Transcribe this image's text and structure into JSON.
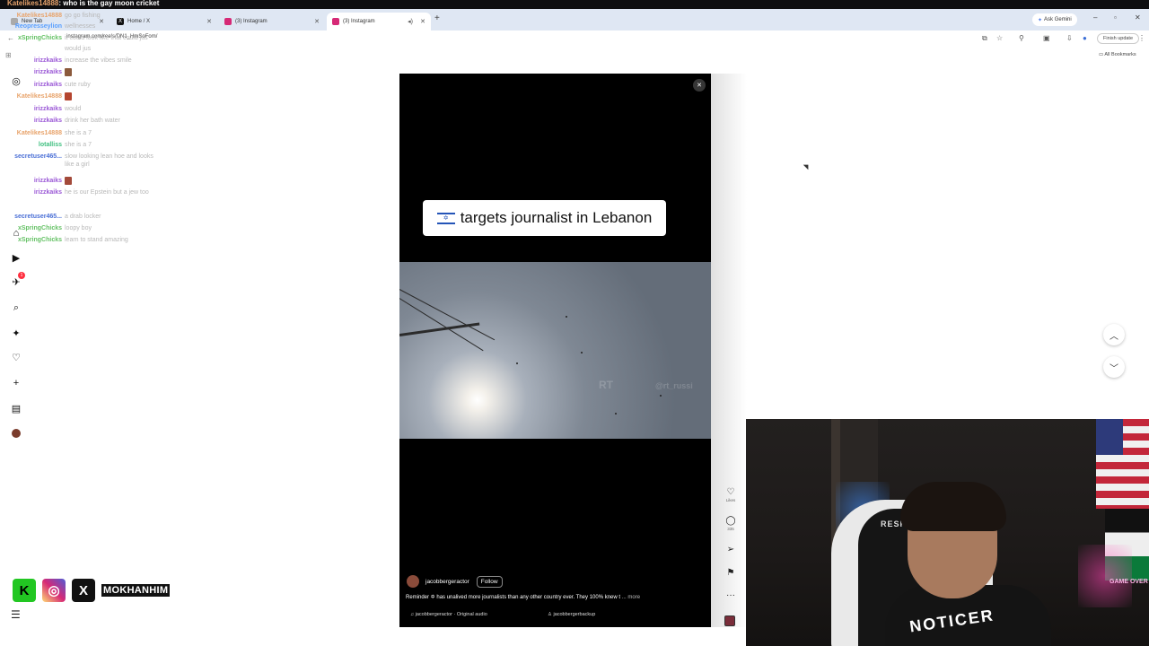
{
  "chat_top": {
    "user": "Katelikes14888",
    "message": "who is the gay moon cricket"
  },
  "browser": {
    "tabs": [
      {
        "label": "New Tab",
        "icon": "chrome-icon"
      },
      {
        "label": "Home / X",
        "icon": "x-icon"
      },
      {
        "label": "(3) Instagram",
        "icon": "instagram-icon"
      },
      {
        "label": "(3) Instagram",
        "icon": "instagram-icon",
        "active": true
      }
    ],
    "address": "instagram.com/reels/DN1_HmSoFom/",
    "ask_gemini": "Ask Gemini",
    "finish_update": "Finish update",
    "all_bookmarks": "All Bookmarks"
  },
  "chat": [
    {
      "user": "Katelikes14888",
      "message": "go go fishing",
      "color": "#e8a36b"
    },
    {
      "user": "Reopresseylion",
      "message": "wellnesses",
      "color": "#5aa0ff"
    },
    {
      "user": "xSpringChicks",
      "message": "it could look like that could jus",
      "color": "#66c266"
    },
    {
      "user": "",
      "message": "would jus",
      "color": "#999999"
    },
    {
      "user": "irizzkaiks",
      "message": "increase the vibes smile",
      "color": "#9b59d6"
    },
    {
      "user": "irizzkaiks",
      "message": "",
      "color": "#9b59d6",
      "emote": true
    },
    {
      "user": "irizzkaiks",
      "message": "cute ruby",
      "color": "#9b59d6"
    },
    {
      "user": "Katelikes14888",
      "message": "",
      "color": "#e8a36b",
      "emote": true
    },
    {
      "user": "irizzkaiks",
      "message": "would",
      "color": "#9b59d6"
    },
    {
      "user": "irizzkaiks",
      "message": "drink her bath water",
      "color": "#9b59d6"
    },
    {
      "user": "Katelikes14888",
      "message": "she is a 7",
      "color": "#e8a36b"
    },
    {
      "user": "lotalliss",
      "message": "she is a 7",
      "color": "#3fbf7f"
    },
    {
      "user": "secretuser465...",
      "message": "slow looking lean hoe and looks like a girl",
      "color": "#4a6fd6"
    },
    {
      "user": "irizzkaiks",
      "message": "",
      "color": "#9b59d6",
      "emote": true
    },
    {
      "user": "irizzkaiks",
      "message": "he is our Epstein but a jew too",
      "color": "#9b59d6"
    },
    {
      "user": "secretuser465...",
      "message": "a drab locker",
      "color": "#4a6fd6"
    },
    {
      "user": "xSpringChicks",
      "message": "loopy boy",
      "color": "#66c266"
    },
    {
      "user": "xSpringChicks",
      "message": "learn to stand amazing",
      "color": "#66c266"
    }
  ],
  "sidebar": {
    "items": [
      {
        "icon": "instagram-logo-icon"
      },
      {
        "icon": "home-icon"
      },
      {
        "icon": "reels-icon"
      },
      {
        "icon": "direct-icon",
        "badge": "1"
      },
      {
        "icon": "search-icon"
      },
      {
        "icon": "explore-icon"
      },
      {
        "icon": "notifications-icon"
      },
      {
        "icon": "create-icon"
      },
      {
        "icon": "dashboard-icon"
      },
      {
        "icon": "profile-icon"
      }
    ]
  },
  "reel": {
    "headline": "targets journalist in Lebanon",
    "flag_icon": "israel-flag-icon",
    "watermark": "@rt_russi",
    "watermark2": "RT",
    "author": "jacobbergeractor",
    "follow_label": "Follow",
    "caption": "Reminder ✡ has unalived more journalists than any other country ever. They 100% knew t",
    "more_label": "... more",
    "audio": "jacobbergeractor · Original audio",
    "tagged": "jacobbergerbackup",
    "likes_label": "Likes",
    "comments_count": "335"
  },
  "cam": {
    "chair_brand": "RESPAWN",
    "shirt": "NOTICER",
    "sign": "GAME OVER"
  },
  "socials": {
    "handle": "MOKHANHIM"
  }
}
